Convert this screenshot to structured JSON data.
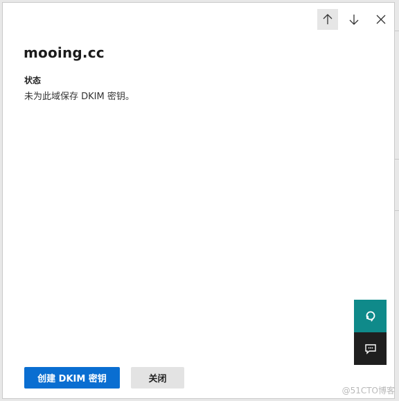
{
  "panel": {
    "title": "mooing.cc",
    "status_label": "状态",
    "status_text": "未为此域保存 DKIM 密钥。"
  },
  "nav": {
    "up_icon": "arrow-up-icon",
    "down_icon": "arrow-down-icon",
    "close_icon": "close-icon"
  },
  "side_actions": {
    "help_icon": "headset-help-icon",
    "feedback_icon": "chat-feedback-icon",
    "help_color": "#0f8a8a",
    "feedback_color": "#1f1f1f"
  },
  "footer": {
    "create_label": "创建 DKIM 密钥",
    "close_label": "关闭",
    "primary_color": "#0a6ed1"
  },
  "watermark": "@51CTO博客"
}
